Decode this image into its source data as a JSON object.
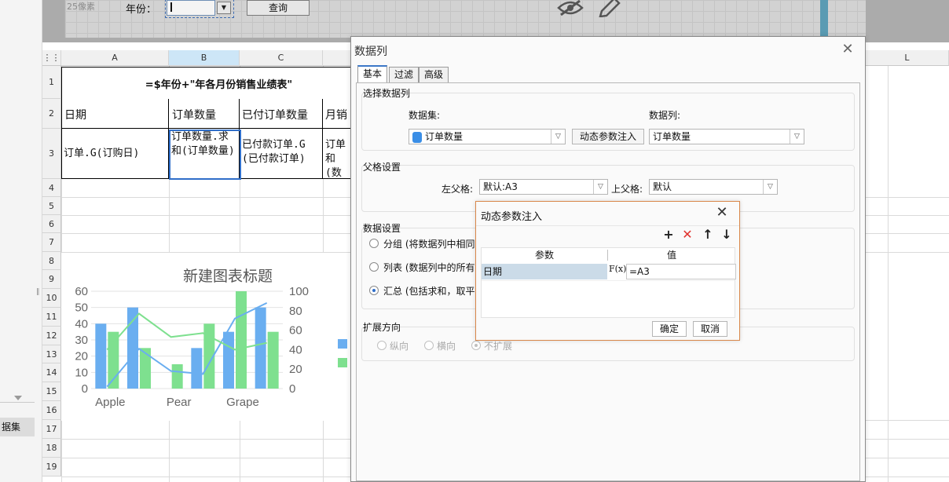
{
  "sidebar": {
    "dataset_tab": "据集"
  },
  "param_bar": {
    "size_hint": "25像素",
    "year_label": "年份：",
    "year_value": "",
    "query_button": "查询"
  },
  "sheet": {
    "columns": [
      "A",
      "B",
      "C",
      "L"
    ],
    "rows": [
      "1",
      "2",
      "3",
      "4",
      "5",
      "6",
      "7",
      "8",
      "9",
      "10",
      "11",
      "12",
      "13",
      "14",
      "15",
      "16",
      "17",
      "18",
      "19"
    ],
    "title_cell": "=$年份+\"年各月份销售业绩表\"",
    "header_row": [
      "日期",
      "订单数量",
      "已付订单数量",
      "月销"
    ],
    "data_row": {
      "a3": "订单.G(订购日)",
      "b3": "订单数量.求和(订单数量)",
      "c3": "已付款订单.G(已付款订单)",
      "d3": "订单和(数"
    }
  },
  "chart_data": {
    "type": "bar",
    "title": "新建图表标题",
    "categories": [
      "Apple",
      "",
      "Pear",
      "",
      "Grape",
      ""
    ],
    "category_labels": [
      "Apple",
      "Pear",
      "Grape"
    ],
    "series": [
      {
        "type": "bar",
        "axis": "left",
        "color": "#6aaef0",
        "values": [
          40,
          50,
          0,
          25,
          35,
          50
        ]
      },
      {
        "type": "bar",
        "axis": "left",
        "color": "#7ee08f",
        "values": [
          35,
          25,
          15,
          40,
          60,
          35
        ]
      },
      {
        "type": "line",
        "axis": "right",
        "color": "#6aaef0",
        "values": [
          2,
          41,
          18,
          15,
          72,
          88
        ]
      },
      {
        "type": "line",
        "axis": "right",
        "color": "#7ee08f",
        "values": [
          40,
          77,
          53,
          57,
          40,
          47
        ]
      }
    ],
    "y_left": {
      "ticks": [
        0,
        10,
        20,
        30,
        40,
        50,
        60
      ],
      "range": [
        0,
        60
      ]
    },
    "y_right": {
      "ticks": [
        0,
        20,
        40,
        60,
        80,
        100
      ],
      "range": [
        0,
        100
      ]
    },
    "legend_colors": [
      "#6aaef0",
      "#7ee08f"
    ],
    "legend_position": "right"
  },
  "data_column_dialog": {
    "title": "数据列",
    "tabs": [
      "基本",
      "过滤",
      "高级"
    ],
    "select_section": "选择数据列",
    "dataset_label": "数据集:",
    "dataset_value": "订单数量",
    "dynamic_param_button": "动态参数注入",
    "column_label": "数据列:",
    "column_value": "订单数量",
    "parent_section": "父格设置",
    "left_parent_label": "左父格:",
    "left_parent_value": "默认:A3",
    "top_parent_label": "上父格:",
    "top_parent_value": "默认",
    "data_section": "数据设置",
    "data_options": [
      "分组 (将数据列中相同",
      "列表 (数据列中的所有数",
      "汇总 (包括求和，取平均"
    ],
    "expand_section": "扩展方向",
    "expand_options": [
      "纵向",
      "横向",
      "不扩展"
    ]
  },
  "param_dialog": {
    "title": "动态参数注入",
    "col_param": "参数",
    "col_value": "值",
    "row_name": "日期",
    "fx_label": "F(x)",
    "row_value": "=A3",
    "ok_button": "确定",
    "cancel_button": "取消"
  },
  "colors": {
    "accent": "#2f6ec9",
    "dialog_border": "#d9874a",
    "delete_red": "#e0322d"
  }
}
